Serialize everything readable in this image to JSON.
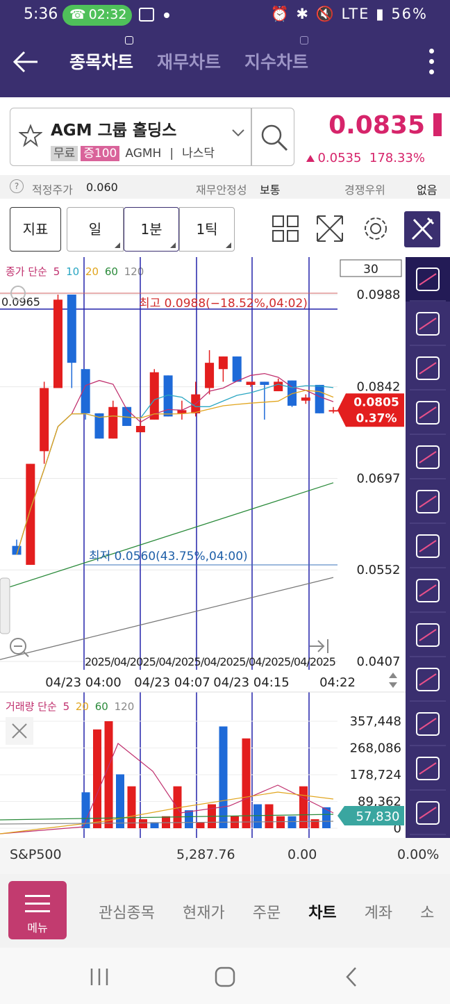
{
  "status": {
    "time": "5:36",
    "call_time": "02:32",
    "battery": "56%",
    "network": "LTE"
  },
  "header": {
    "tabs": [
      "종목차트",
      "재무차트",
      "지수차트"
    ],
    "active_tab": 0
  },
  "stock": {
    "name": "AGM 그룹 홀딩스",
    "tags": [
      "무료",
      "증100",
      "AGMH",
      "나스닥"
    ],
    "price": "0.0835",
    "change": "0.0535",
    "change_pct": "178.33%"
  },
  "info": {
    "fair_label": "적정주가",
    "fair_value": "0.060",
    "stability_label": "재무안정성",
    "stability_value": "보통",
    "competition_label": "경쟁우위",
    "competition_value": "없음"
  },
  "toolbar": {
    "indicator": "지표",
    "day": "일",
    "minute": "1분",
    "tick": "1틱"
  },
  "chart_data": {
    "type": "candlestick",
    "legend_price": {
      "label": "종가 단순",
      "periods": [
        "5",
        "10",
        "20",
        "60",
        "120"
      ]
    },
    "legend_volume": {
      "label": "거래량 단순",
      "periods": [
        "5",
        "20",
        "60",
        "120"
      ]
    },
    "period_box": "30",
    "y_ticks": [
      "0.0988",
      "0.0842",
      "0.0697",
      "0.0552",
      "0.0407"
    ],
    "volume_ticks": [
      "357,448",
      "268,086",
      "178,724",
      "89,362",
      "0"
    ],
    "current_price_label": "0.0805",
    "current_pct_label": "0.37%",
    "current_volume_label": "57,830",
    "crosshair_price": "0.0965",
    "high_annotation": "최고 0.0988(−18.52%,04:02)",
    "low_annotation": "최저 0.0560(43.75%,04:00)",
    "x_ticks": [
      "04/23 04:00",
      "04/23 04:07",
      "04/23 04:15",
      "04:22"
    ],
    "x_date_overlap": "2025/04/2025/04/2025/04/2025/04/2025/04/2025",
    "ylim": [
      0.0407,
      0.0988
    ],
    "candles": [
      {
        "o": 0.059,
        "h": 0.06,
        "l": 0.0578,
        "c": 0.0576
      },
      {
        "o": 0.056,
        "h": 0.072,
        "l": 0.056,
        "c": 0.072
      },
      {
        "o": 0.074,
        "h": 0.085,
        "l": 0.072,
        "c": 0.084
      },
      {
        "o": 0.084,
        "h": 0.0988,
        "l": 0.084,
        "c": 0.098
      },
      {
        "o": 0.0988,
        "h": 0.0988,
        "l": 0.084,
        "c": 0.088
      },
      {
        "o": 0.087,
        "h": 0.087,
        "l": 0.079,
        "c": 0.08
      },
      {
        "o": 0.08,
        "h": 0.08,
        "l": 0.076,
        "c": 0.076
      },
      {
        "o": 0.076,
        "h": 0.082,
        "l": 0.076,
        "c": 0.081
      },
      {
        "o": 0.081,
        "h": 0.081,
        "l": 0.078,
        "c": 0.078
      },
      {
        "o": 0.077,
        "h": 0.079,
        "l": 0.077,
        "c": 0.078
      },
      {
        "o": 0.079,
        "h": 0.087,
        "l": 0.079,
        "c": 0.0865
      },
      {
        "o": 0.086,
        "h": 0.086,
        "l": 0.0795,
        "c": 0.0795
      },
      {
        "o": 0.08,
        "h": 0.082,
        "l": 0.079,
        "c": 0.0805
      },
      {
        "o": 0.08,
        "h": 0.085,
        "l": 0.0795,
        "c": 0.083
      },
      {
        "o": 0.084,
        "h": 0.09,
        "l": 0.083,
        "c": 0.088
      },
      {
        "o": 0.087,
        "h": 0.089,
        "l": 0.085,
        "c": 0.089
      },
      {
        "o": 0.089,
        "h": 0.089,
        "l": 0.085,
        "c": 0.085
      },
      {
        "o": 0.0845,
        "h": 0.0845,
        "l": 0.0842,
        "c": 0.085
      },
      {
        "o": 0.085,
        "h": 0.085,
        "l": 0.079,
        "c": 0.0845
      },
      {
        "o": 0.0835,
        "h": 0.0855,
        "l": 0.0835,
        "c": 0.085
      },
      {
        "o": 0.0852,
        "h": 0.0852,
        "l": 0.081,
        "c": 0.0812
      },
      {
        "o": 0.082,
        "h": 0.083,
        "l": 0.0815,
        "c": 0.0825
      },
      {
        "o": 0.0845,
        "h": 0.0845,
        "l": 0.08,
        "c": 0.08
      },
      {
        "o": 0.0805,
        "h": 0.081,
        "l": 0.08,
        "c": 0.0805
      }
    ],
    "volumes": [
      0,
      0,
      0,
      0,
      0,
      0,
      0,
      120000,
      330000,
      357448,
      180000,
      140000,
      30000,
      20000,
      40000,
      140000,
      60000,
      20000,
      80000,
      340000,
      40000,
      300000,
      80000,
      80000,
      40000,
      40000,
      140000,
      30000,
      70000
    ]
  },
  "bottom": {
    "index_name": "S&P500",
    "index_value": "5,287.76",
    "change": "0.00",
    "pct": "0.00%"
  },
  "menu": {
    "button_label": "메뉴",
    "items": [
      "관심종목",
      "현재가",
      "주문",
      "차트",
      "계좌",
      "소"
    ],
    "active": "차트"
  }
}
